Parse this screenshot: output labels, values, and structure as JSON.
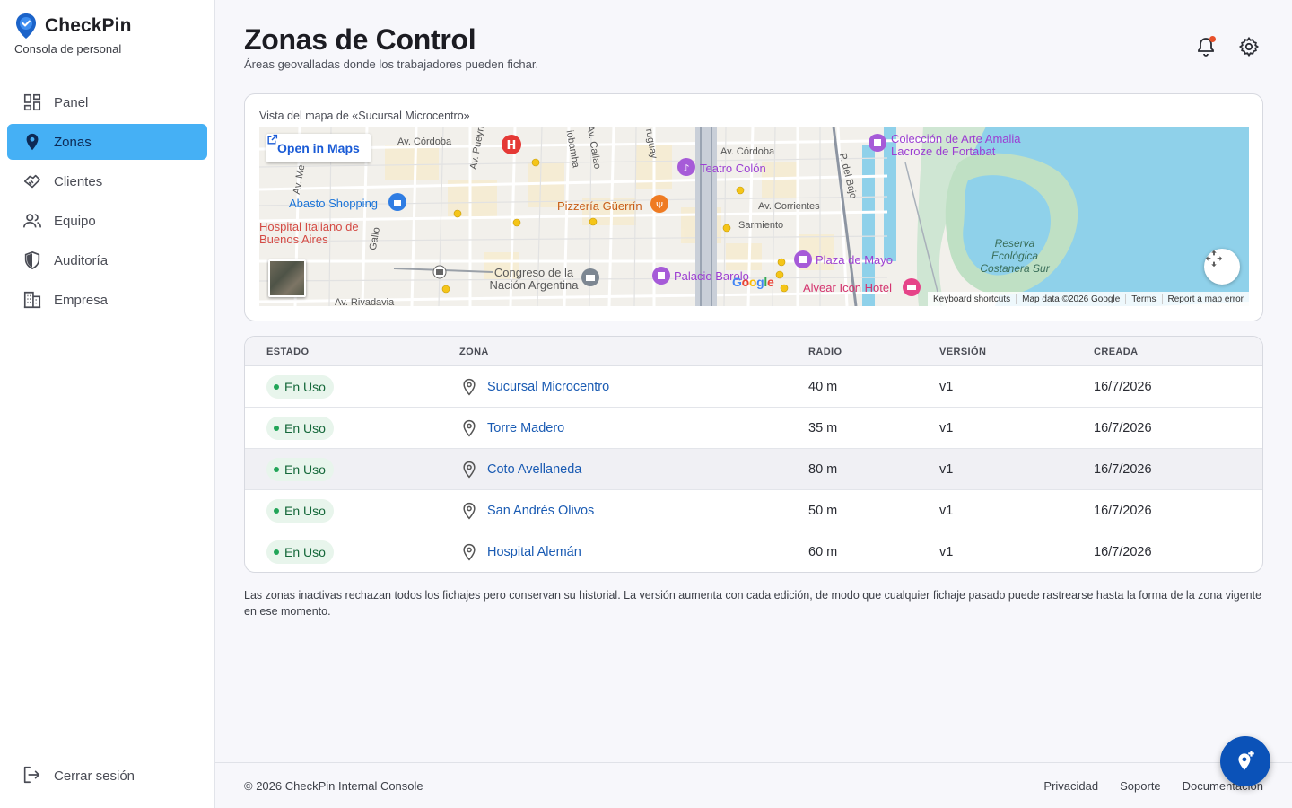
{
  "brand": {
    "name": "CheckPin",
    "subtitle": "Consola de personal"
  },
  "sidebar": {
    "items": [
      {
        "label": "Panel",
        "icon": "dashboard-icon",
        "active": false
      },
      {
        "label": "Zonas",
        "icon": "location-pin-icon",
        "active": true
      },
      {
        "label": "Clientes",
        "icon": "handshake-icon",
        "active": false
      },
      {
        "label": "Equipo",
        "icon": "people-icon",
        "active": false
      },
      {
        "label": "Auditoría",
        "icon": "shield-icon",
        "active": false
      },
      {
        "label": "Empresa",
        "icon": "building-icon",
        "active": false
      }
    ],
    "logout_label": "Cerrar sesión"
  },
  "header": {
    "title": "Zonas de Control",
    "subtitle": "Áreas geovalladas donde los trabajadores pueden fichar."
  },
  "map": {
    "caption": "Vista del mapa de «Sucursal Microcentro»",
    "open_in_maps": "Open in Maps",
    "labels": {
      "av_cordoba_1": "Av. Córdoba",
      "av_cordoba_2": "Av. Córdoba",
      "av_corrientes": "Av. Corrientes",
      "sarmiento": "Sarmiento",
      "av_rivadavia": "Av. Rivadavia",
      "gallo": "Gallo",
      "av_pueyrredon": "Av. Pueyrr",
      "av_me": "Av. Me",
      "callao": "Av. Callao",
      "viamonte": "iobamba",
      "uruguay": "ruguay",
      "paseo_bajo": "P. del Bajo",
      "abasto": "Abasto Shopping",
      "hospital_italiano": "Hospital Italiano de Buenos Aires",
      "pizzeria": "Pizzería Güerrín",
      "teatro_colon": "Teatro Colón",
      "congreso": "Congreso de la Nación Argentina",
      "palacio_barolo": "Palacio Barolo",
      "plaza_de_mayo": "Plaza de Mayo",
      "alvear": "Alvear Icon Hotel",
      "coleccion": "Colección de Arte Amalia Lacroze de Fortabat",
      "reserva": "Reserva Ecológica Costanera Sur"
    },
    "attribution": {
      "shortcuts": "Keyboard shortcuts",
      "data": "Map data ©2026 Google",
      "terms": "Terms",
      "report": "Report a map error"
    }
  },
  "table": {
    "headers": {
      "estado": "ESTADO",
      "zona": "ZONA",
      "radio": "RADIO",
      "version": "VERSIÓN",
      "creada": "CREADA"
    },
    "rows": [
      {
        "estado": "En Uso",
        "zona": "Sucursal Microcentro",
        "radio": "40 m",
        "version": "v1",
        "creada": "16/7/2026"
      },
      {
        "estado": "En Uso",
        "zona": "Torre Madero",
        "radio": "35 m",
        "version": "v1",
        "creada": "16/7/2026"
      },
      {
        "estado": "En Uso",
        "zona": "Coto Avellaneda",
        "radio": "80 m",
        "version": "v1",
        "creada": "16/7/2026"
      },
      {
        "estado": "En Uso",
        "zona": "San Andrés Olivos",
        "radio": "50 m",
        "version": "v1",
        "creada": "16/7/2026"
      },
      {
        "estado": "En Uso",
        "zona": "Hospital Alemán",
        "radio": "60 m",
        "version": "v1",
        "creada": "16/7/2026"
      }
    ]
  },
  "note": "Las zonas inactivas rechazan todos los fichajes pero conservan su historial. La versión aumenta con cada edición, de modo que cualquier fichaje pasado puede rastrearse hasta la forma de la zona vigente en ese momento.",
  "footer": {
    "copyright": "© 2026 CheckPin Internal Console",
    "links": [
      "Privacidad",
      "Soporte",
      "Documentación"
    ]
  },
  "colors": {
    "accent": "#45b0f5",
    "fab": "#0b52b8",
    "link": "#1a5bb3",
    "status_bg": "#e8f5ec",
    "status_text": "#15683a",
    "notification": "#e8512b"
  }
}
